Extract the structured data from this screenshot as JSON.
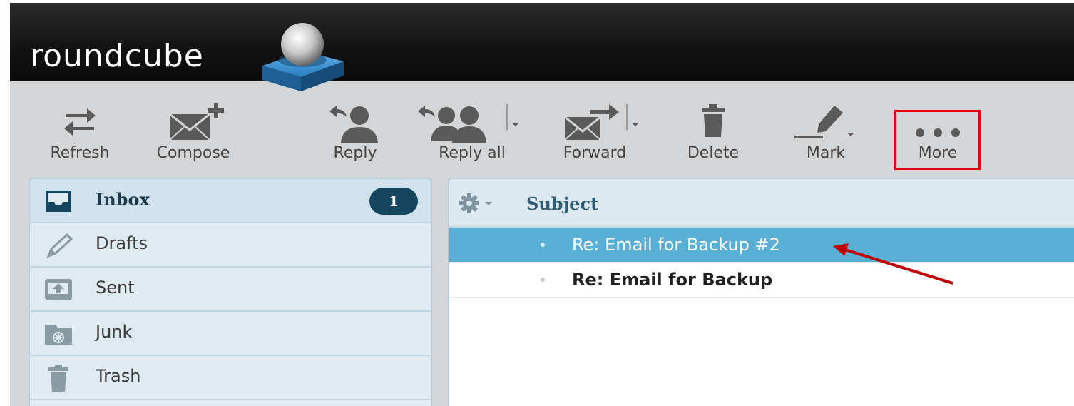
{
  "app": {
    "logo_text": "roundcube"
  },
  "toolbar": {
    "refresh": "Refresh",
    "compose": "Compose",
    "reply": "Reply",
    "reply_all": "Reply all",
    "forward": "Forward",
    "delete": "Delete",
    "mark": "Mark",
    "more": "More"
  },
  "folders": [
    {
      "name": "Inbox",
      "icon": "inbox-icon",
      "unread": "1",
      "selected": true
    },
    {
      "name": "Drafts",
      "icon": "pencil-icon"
    },
    {
      "name": "Sent",
      "icon": "sent-tray-icon"
    },
    {
      "name": "Junk",
      "icon": "junk-icon"
    },
    {
      "name": "Trash",
      "icon": "trash-icon"
    }
  ],
  "message_list": {
    "subject_header": "Subject",
    "rows": [
      {
        "subject": "Re: Email for Backup #2",
        "selected": true
      },
      {
        "subject": "Re: Email for Backup",
        "unread": true
      }
    ]
  },
  "colors": {
    "accent": "#5aafd5",
    "badge": "#14475e",
    "highlight": "#e60000",
    "annotation_arrow": "#c00000"
  }
}
